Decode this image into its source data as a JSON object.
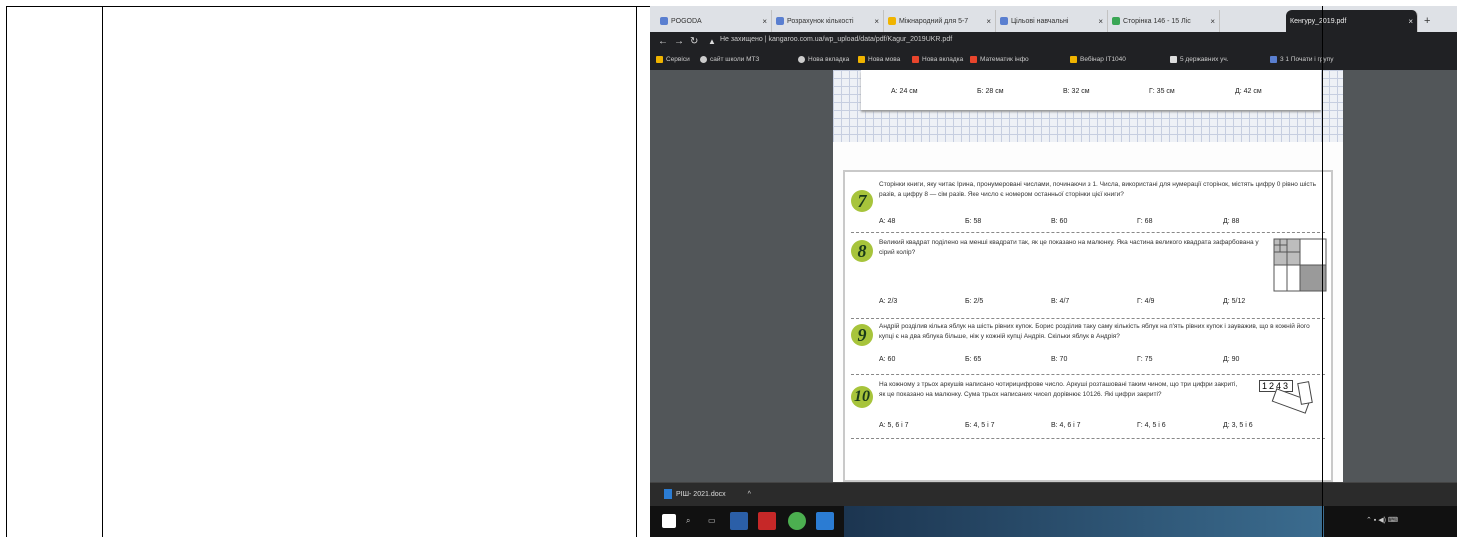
{
  "browser": {
    "tabs": [
      {
        "label": "POGODA",
        "active": false
      },
      {
        "label": "Розрахунок кількості",
        "active": false
      },
      {
        "label": "Міжнародний для 5-7",
        "active": false
      },
      {
        "label": "Цільові навчальні",
        "active": false
      },
      {
        "label": "Сторінка 146 - 15 Ліс",
        "active": false
      },
      {
        "label": "Кенгуру_2019.pdf",
        "active": true
      }
    ],
    "new_tab": "+",
    "address": {
      "security": "Не захищено",
      "url": "kangaroo.com.ua/wp_upload/data/pdf/Kagur_2019UKR.pdf"
    },
    "bookmarks": [
      "Сервіси",
      "сайт школи МТЗ",
      "Нова вкладка",
      "Нова мова",
      "Нова вкладка",
      "Математик інфо",
      "Вебінар ІТ1040",
      "5 державних уч.",
      "3 1 Почати і групу"
    ]
  },
  "pdf": {
    "prev_answers": [
      "А: 24 см",
      "Б: 28 см",
      "В: 32 см",
      "Г: 35 см",
      "Д: 42 см"
    ],
    "questions": [
      {
        "num": "7",
        "text": "Сторінки книги, яку читає Ірина, пронумеровані числами, починаючи з 1. Числа, використані для нумерації сторінок, містять цифру 0 рівно шість разів, а цифру 8 — сім разів. Яке число є номером останньої сторінки цієї книги?",
        "answers": [
          "А: 48",
          "Б: 58",
          "В: 60",
          "Г: 68",
          "Д: 88"
        ]
      },
      {
        "num": "8",
        "text": "Великий квадрат поділено на менші квадрати так, як це показано на малюнку. Яка частина великого квадрата зафарбована у сірий колір?",
        "answers": [
          "А: 2/3",
          "Б: 2/5",
          "В: 4/7",
          "Г: 4/9",
          "Д: 5/12"
        ]
      },
      {
        "num": "9",
        "text": "Андрій розділив кілька яблук на шість рівних купок. Борис розділив таку саму кількість яблук на п'ять рівних купок і зауважив, що в кожній його купці є на два яблука більше, ніж у кожній купці Андрія. Скільки яблук в Андрія?",
        "answers": [
          "А: 60",
          "Б: 65",
          "В: 70",
          "Г: 75",
          "Д: 90"
        ]
      },
      {
        "num": "10",
        "text": "На кожному з трьох аркушів написано чотирицифрове число. Аркуші розташовані таким чином, що три цифри закриті, як це показано на малюнку. Сума трьох написаних чисел дорівнює 10126. Які цифри закриті?",
        "answers": [
          "А: 5, 6 і 7",
          "Б: 4, 5 і 7",
          "В: 4, 6 і 7",
          "Г: 4, 5 і 6",
          "Д: 3, 5 і 6"
        ]
      }
    ],
    "card_digits": "1243"
  },
  "download": {
    "filename": "РІШ- 2021.docx",
    "chevron": "^"
  }
}
